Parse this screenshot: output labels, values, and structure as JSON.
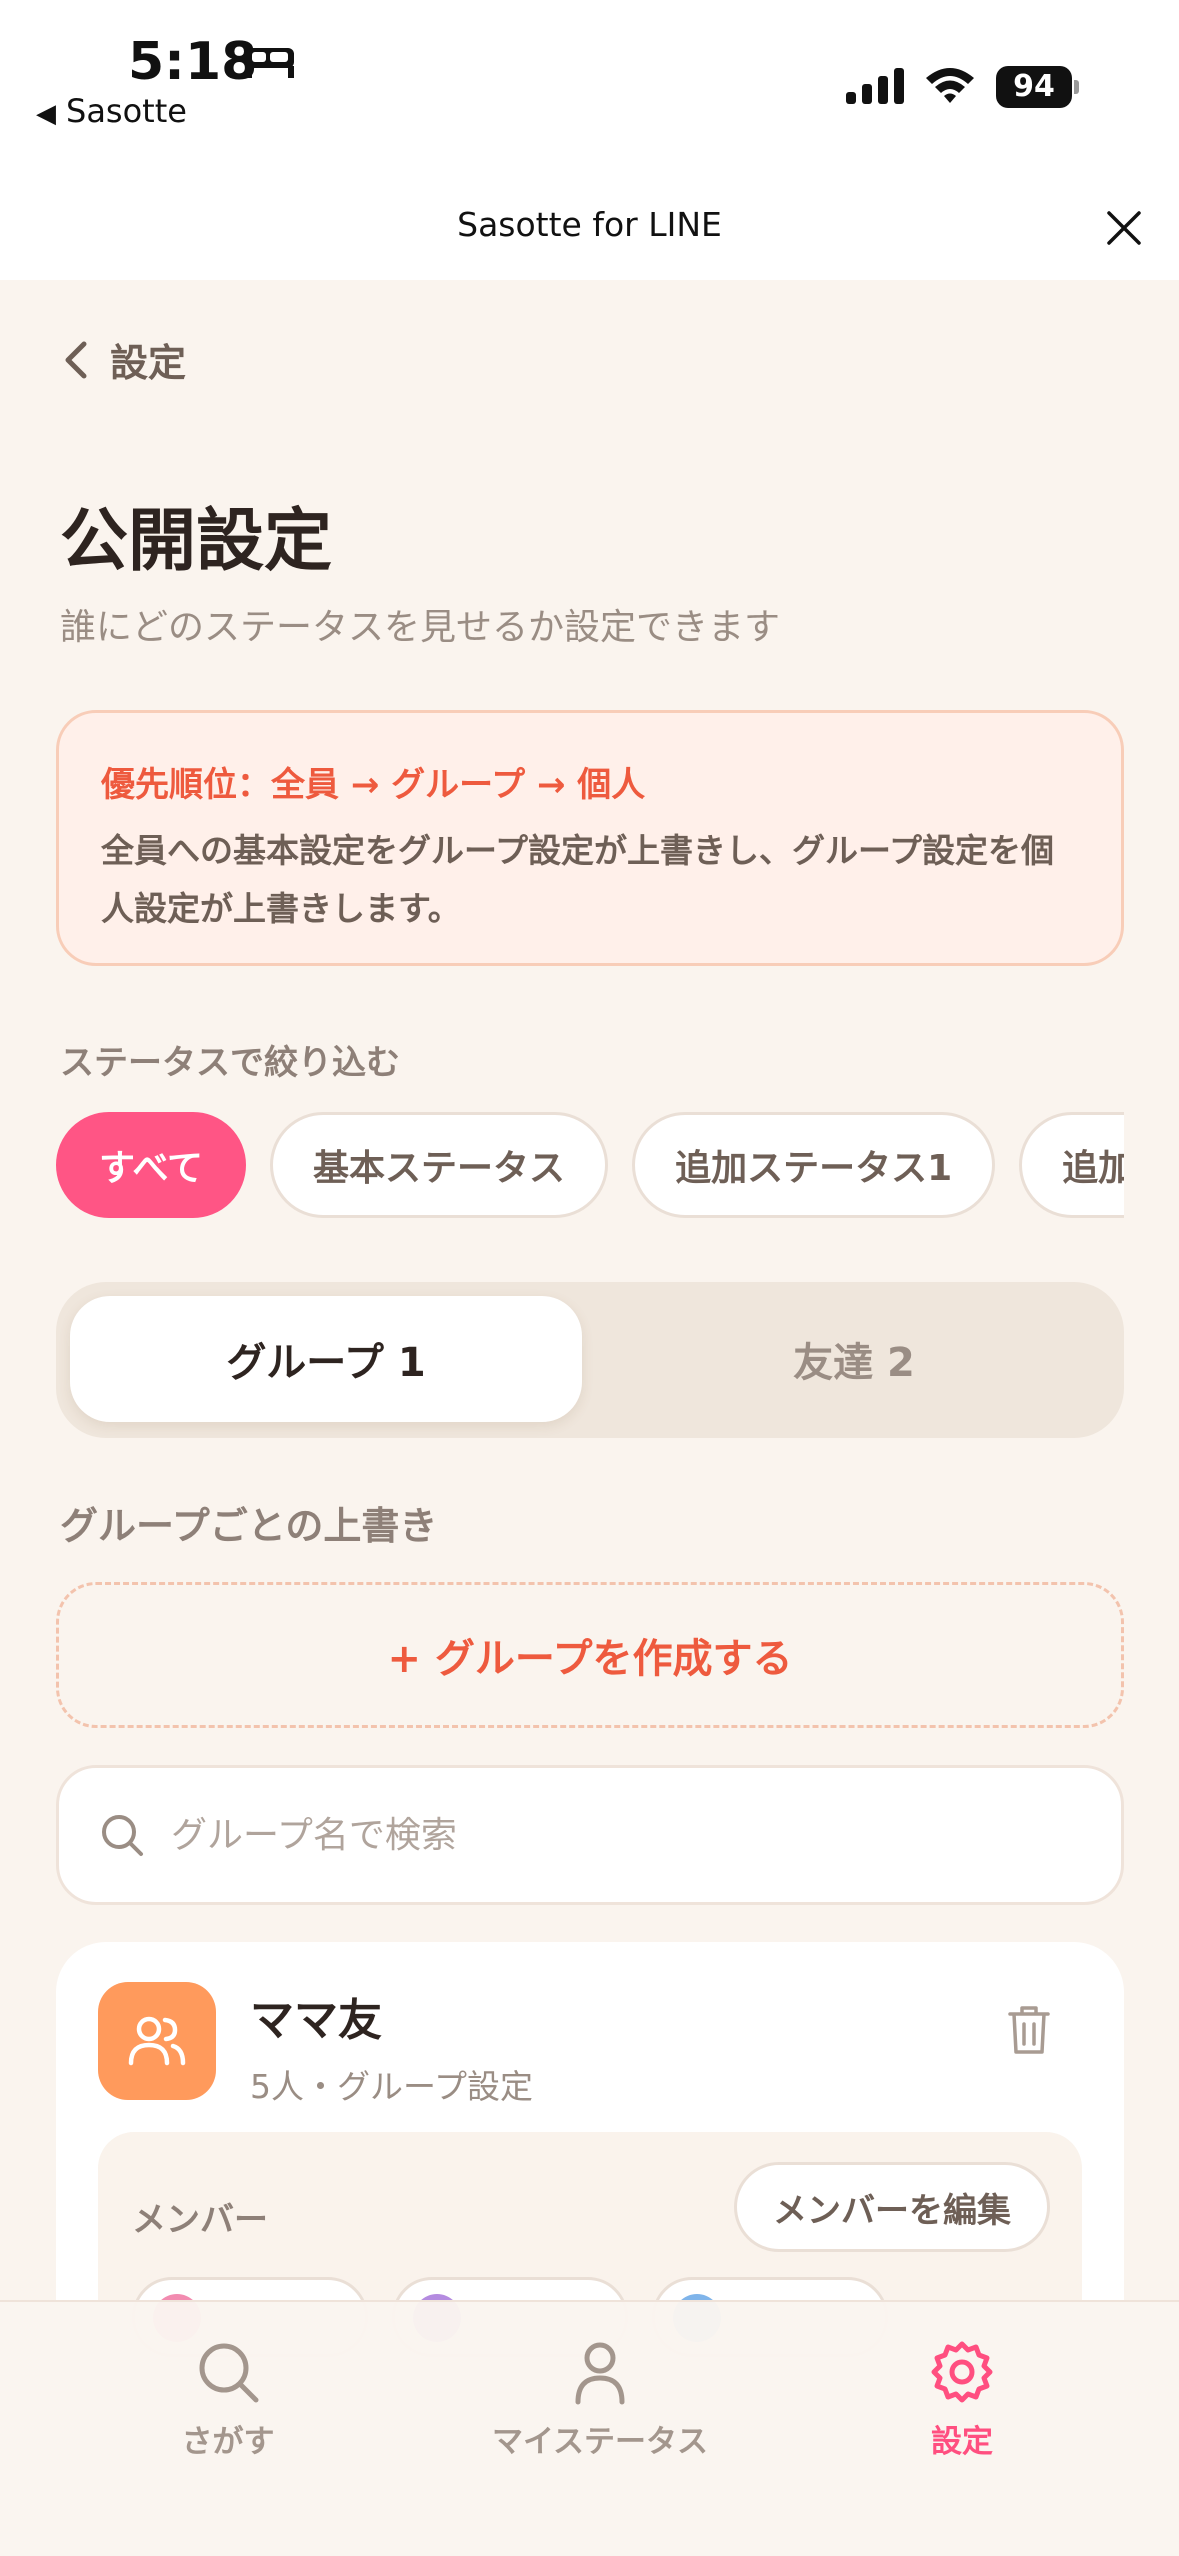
{
  "status_bar": {
    "time": "5:18",
    "back_app": "Sasotte",
    "battery": "94"
  },
  "title_bar": {
    "title": "Sasotte for LINE"
  },
  "header": {
    "back_label": "設定",
    "title": "公開設定",
    "subtitle": "誰にどのステータスを見せるか設定できます"
  },
  "notice": {
    "heading": "優先順位：全員 → グループ → 個人",
    "body": "全員への基本設定をグループ設定が上書きし、グループ設定を個人設定が上書きします。"
  },
  "filter": {
    "label": "ステータスで絞り込む",
    "chips": [
      "すべて",
      "基本ステータス",
      "追加ステータス1",
      "追加"
    ]
  },
  "segment": {
    "tabs": [
      "グループ 1",
      "友達 2"
    ],
    "selected": 0
  },
  "groups_section": {
    "label": "グループごとの上書き",
    "create_button": "+ グループを作成する",
    "search_placeholder": "グループ名で検索",
    "groups": [
      {
        "name": "ママ友",
        "meta": "5人・グループ設定",
        "member_label": "メンバー",
        "edit_button": "メンバーを編集"
      }
    ]
  },
  "bottom_nav": {
    "items": [
      "さがす",
      "マイステータス",
      "設定"
    ],
    "active": 2
  },
  "colors": {
    "accent_pink": "#ff5585",
    "accent_orange": "#ee5a3e",
    "group_avatar": "#ff9a5c",
    "background": "#faf4ee"
  }
}
